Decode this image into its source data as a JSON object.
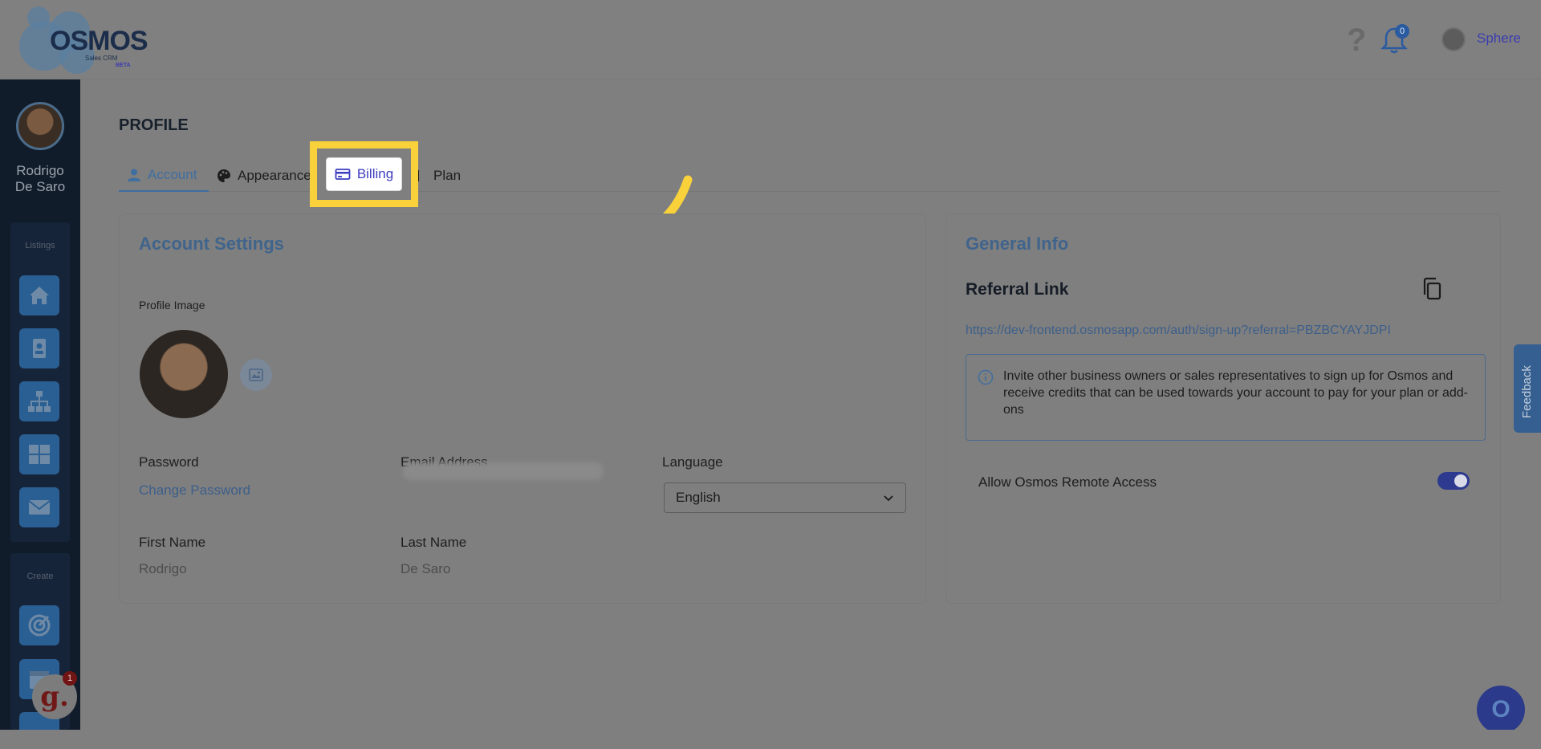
{
  "header": {
    "logo_text": "OSMOS",
    "logo_sub": "Sales CRM",
    "logo_beta": "BETA",
    "help_symbol": "?",
    "notification_count": "0",
    "user_name": "Sphere"
  },
  "sidebar": {
    "user_first": "Rodrigo",
    "user_last": "De Saro",
    "section_listings": "Listings",
    "section_create": "Create",
    "listings_icons": [
      "home-icon",
      "contact-card-icon",
      "org-chart-icon",
      "dashboard-grid-icon",
      "mail-icon"
    ],
    "create_icons": [
      "target-icon",
      "calendar-icon"
    ]
  },
  "page": {
    "title": "PROFILE",
    "tabs": [
      {
        "label": "Account",
        "icon": "user-icon"
      },
      {
        "label": "Appearance",
        "icon": "palette-icon"
      },
      {
        "label": "Billing",
        "icon": "credit-card-icon"
      },
      {
        "label": "Plan",
        "icon": "plan-icon"
      }
    ]
  },
  "account_settings": {
    "title": "Account Settings",
    "profile_image_label": "Profile Image",
    "password_label": "Password",
    "change_password": "Change Password",
    "email_label": "Email Address",
    "language_label": "Language",
    "language_value": "English",
    "first_name_label": "First Name",
    "first_name_value": "Rodrigo",
    "last_name_label": "Last Name",
    "last_name_value": "De Saro"
  },
  "general_info": {
    "title": "General Info",
    "referral_title": "Referral Link",
    "referral_url": "https://dev-frontend.osmosapp.com/auth/sign-up?referral=PBZBCYAYJDPI",
    "info_text": "Invite other business owners or sales representatives to sign up for Osmos and receive credits that can be used towards your account to pay for your plan or add-ons",
    "remote_access_label": "Allow Osmos Remote Access",
    "remote_access_on": true
  },
  "widgets": {
    "feedback_label": "Feedback",
    "chat_letter": "O",
    "g_letter": "g.",
    "g_badge": "1"
  },
  "colors": {
    "highlight": "#f9d23b",
    "accent": "#3f6ea0",
    "sidebar_bg": "#111c2b"
  }
}
